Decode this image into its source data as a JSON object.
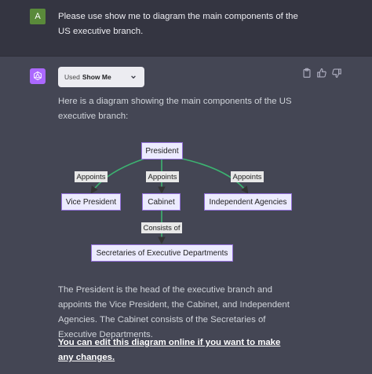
{
  "user": {
    "avatar_letter": "A",
    "message": "Please use show me to diagram the main components of the US executive branch."
  },
  "assistant": {
    "plugin_prefix": "Used",
    "plugin_name": "Show Me",
    "intro": "Here is a diagram showing the main components of the US executive branch:",
    "summary": "The President is the head of the executive branch and appoints the Vice President, the Cabinet, and Independent Agencies. The Cabinet consists of the Secretaries of Executive Departments.",
    "edit_link": "You can edit this diagram online if you want to make any changes."
  },
  "diagram": {
    "nodes": {
      "president": "President",
      "vice_president": "Vice President",
      "cabinet": "Cabinet",
      "agencies": "Independent Agencies",
      "secretaries": "Secretaries of Executive Departments"
    },
    "edges": {
      "appoints_vp": "Appoints",
      "appoints_cabinet": "Appoints",
      "appoints_agencies": "Appoints",
      "consists_of": "Consists of"
    },
    "colors": {
      "edge": "#3cb371",
      "node_fill": "#ecebfe",
      "node_border": "#9370db"
    }
  },
  "icons": {
    "copy": "clipboard-icon",
    "like": "thumbs-up-icon",
    "dislike": "thumbs-down-icon",
    "chip_chevron": "chevron-down-icon",
    "bot": "openai-logo-icon"
  }
}
